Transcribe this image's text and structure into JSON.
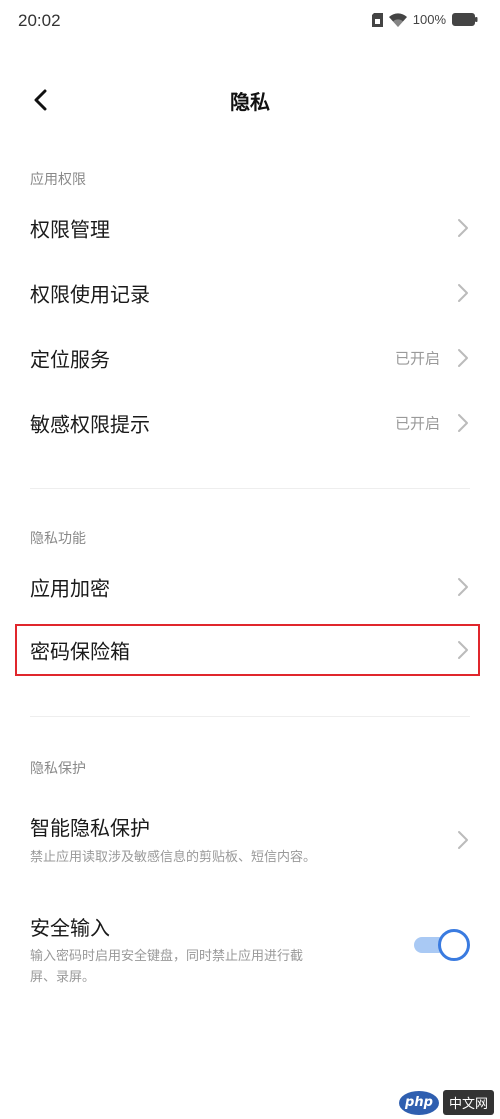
{
  "status_bar": {
    "time": "20:02",
    "battery": "100%",
    "icons": [
      "sim-icon",
      "wifi-icon",
      "battery-icon"
    ]
  },
  "nav": {
    "title": "隐私",
    "back_icon": "chevron-left-icon"
  },
  "sections": [
    {
      "header": "应用权限",
      "items": [
        {
          "label": "权限管理",
          "value": ""
        },
        {
          "label": "权限使用记录",
          "value": ""
        },
        {
          "label": "定位服务",
          "value": "已开启"
        },
        {
          "label": "敏感权限提示",
          "value": "已开启"
        }
      ]
    },
    {
      "header": "隐私功能",
      "items": [
        {
          "label": "应用加密",
          "value": ""
        },
        {
          "label": "密码保险箱",
          "value": "",
          "highlighted": true
        }
      ]
    },
    {
      "header": "隐私保护",
      "items": [
        {
          "label": "智能隐私保护",
          "description": "禁止应用读取涉及敏感信息的剪贴板、短信内容。"
        },
        {
          "label": "安全输入",
          "description_lines": [
            "输入密码时启用安全键盘，同时禁止应用进行截",
            "屏、录屏。"
          ],
          "toggle_on": true
        }
      ]
    }
  ],
  "watermark": {
    "logo": "php",
    "text": "中文网"
  },
  "colors": {
    "highlight": "#e0262c",
    "toggle_accent": "#3a7be0"
  }
}
